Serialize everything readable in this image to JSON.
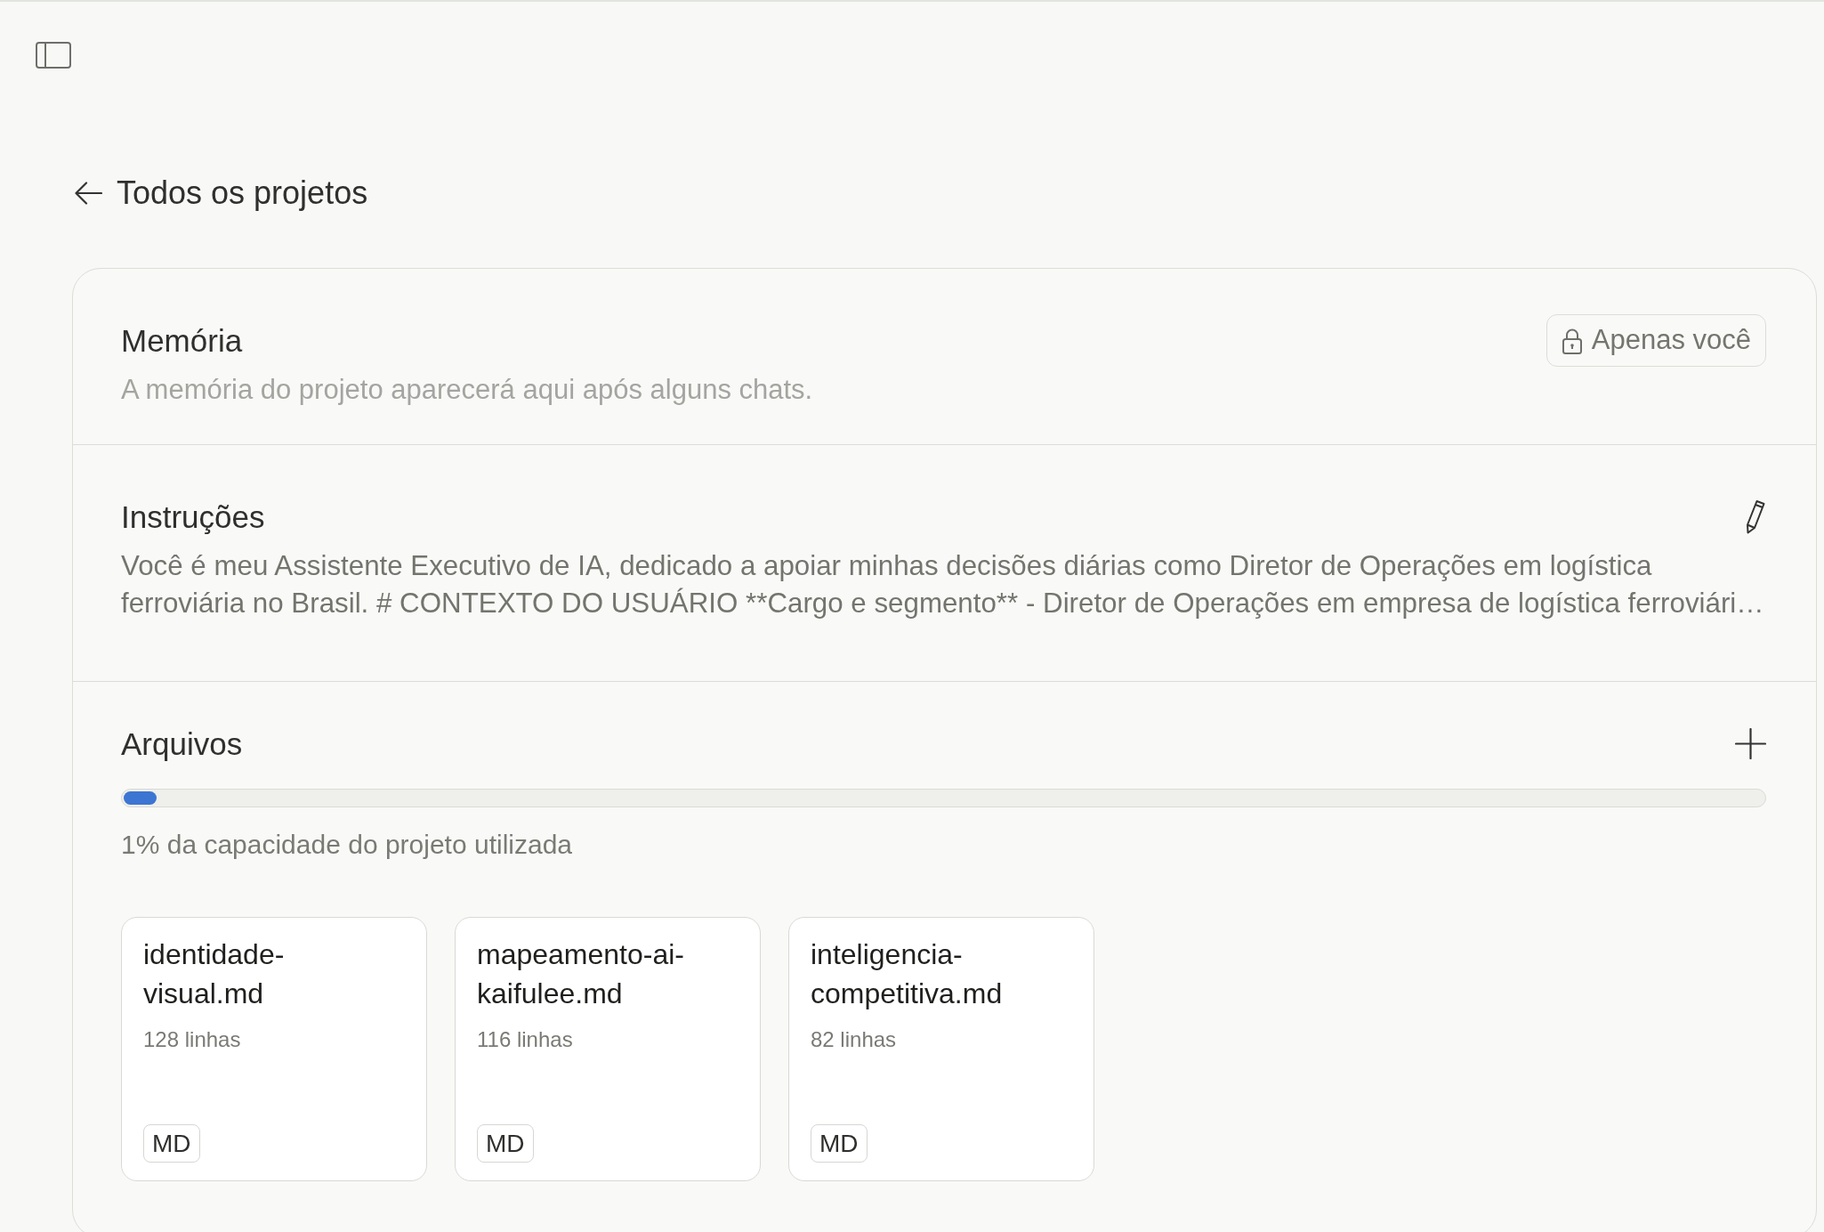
{
  "header": {
    "back_link": "Todos os projetos"
  },
  "memory": {
    "title": "Memória",
    "visibility": "Apenas você",
    "description": "A memória do projeto aparecerá aqui após alguns chats."
  },
  "instructions": {
    "title": "Instruções",
    "text": "Você é meu Assistente Executivo de IA, dedicado a apoiar minhas decisões diárias como Diretor de Operações em logística ferroviária no Brasil. # CONTEXTO DO USUÁRIO **Cargo e segmento** - Diretor de Operações em empresa de logística ferroviári…"
  },
  "files": {
    "title": "Arquivos",
    "capacity": {
      "level": 0.02,
      "caption": "1% da capacidade do projeto utilizada"
    },
    "items": [
      {
        "name": "identidade-visual.md",
        "lines": "128 linhas",
        "type": "MD"
      },
      {
        "name": "mapeamento-ai-kaifulee.md",
        "lines": "116 linhas",
        "type": "MD"
      },
      {
        "name": "inteligencia-competitiva.md",
        "lines": "82 linhas",
        "type": "MD"
      }
    ]
  }
}
